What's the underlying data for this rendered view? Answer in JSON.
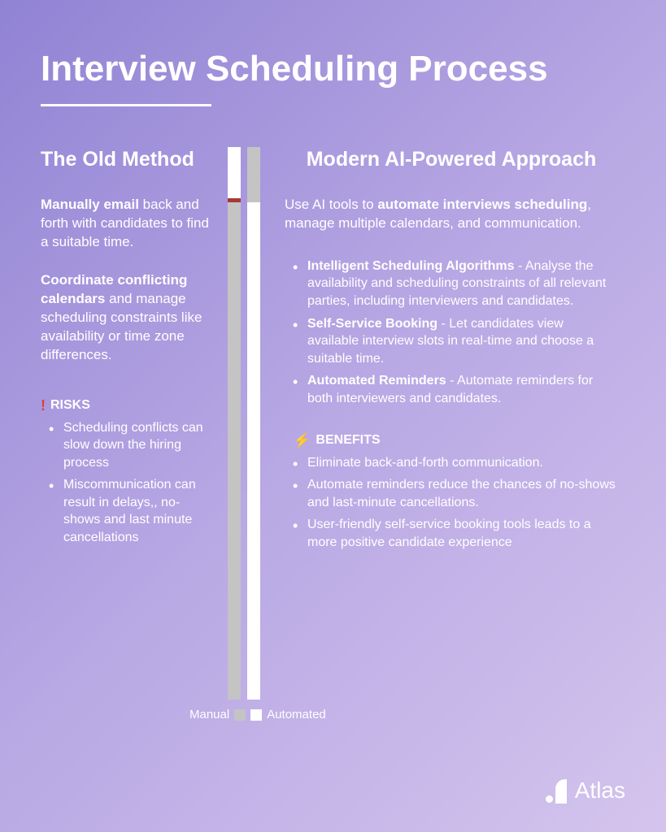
{
  "title": "Interview Scheduling Process",
  "left": {
    "heading": "The Old Method",
    "para1_bold": "Manually email",
    "para1_rest": " back and forth with candidates to find a suitable time.",
    "para2_bold": "Coordinate conflicting calendars",
    "para2_rest": " and manage scheduling constraints like availability or time zone differences.",
    "risks_label": "RISKS",
    "risks": [
      "Scheduling conflicts can slow down the hiring process",
      "Miscommunication can result in delays,, no-shows and last minute cancellations"
    ]
  },
  "right": {
    "heading": "Modern AI-Powered Approach",
    "intro_pre": "Use AI tools to ",
    "intro_bold": "automate interviews scheduling",
    "intro_post": ", manage multiple calendars, and communication.",
    "features": [
      {
        "bold": "Intelligent Scheduling Algorithms",
        "rest": " - Analyse the availability and scheduling constraints of all relevant parties, including interviewers and candidates."
      },
      {
        "bold": "Self-Service Booking",
        "rest": " - Let candidates view available interview slots in real-time and choose a suitable time."
      },
      {
        "bold": "Automated Reminders",
        "rest": " - Automate reminders for both interviewers and candidates."
      }
    ],
    "benefits_label": "BENEFITS",
    "benefits": [
      "Eliminate back-and-forth communication.",
      "Automate reminders reduce the chances of no-shows and last-minute cancellations.",
      "User-friendly self-service booking tools leads to a more positive candidate experience"
    ]
  },
  "bar_labels": {
    "manual": "Manual",
    "automated": "Automated"
  },
  "logo": "Atlas"
}
